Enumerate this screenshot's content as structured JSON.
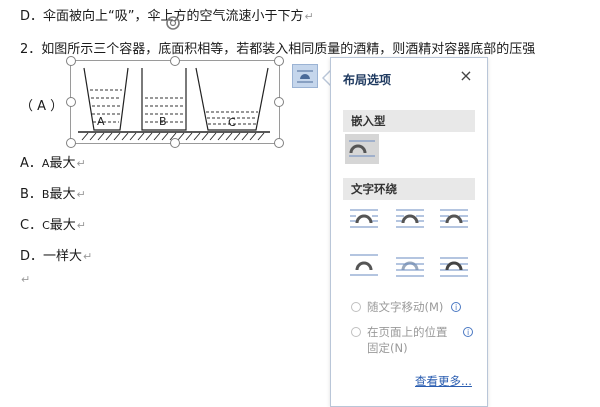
{
  "question": {
    "option_d_prev": "D．伞面被向上“吸”，伞上方的空气流速小于下方",
    "stem": "2．如图所示三个容器，底面积相等，若都装入相同质量的酒精，则酒精对容器底部的压强",
    "answer_open": "（  A  ）",
    "options": [
      {
        "letter_text": "A．",
        "small": "A",
        "text": "最大"
      },
      {
        "letter_text": "B．",
        "small": "B",
        "text": "最大"
      },
      {
        "letter_text": "C．",
        "small": "C",
        "text": "最大"
      },
      {
        "letter_text": "D．",
        "small": "",
        "text": "一样大"
      }
    ],
    "paragraph_mark": "↵",
    "figure_labels": [
      "A",
      "B",
      "C"
    ]
  },
  "layout_panel": {
    "title": "布局选项",
    "close": "×",
    "inline_section": "嵌入型",
    "wrap_section": "文字环绕",
    "move_with_text": "随文字移动(M)",
    "fix_position_line1": "在页面上的位置",
    "fix_position_line2": "固定(N)",
    "info_glyph": "i",
    "see_more": "查看更多..."
  },
  "icons": {
    "layout_button": "layout-options-icon",
    "rotate": "rotate-handle-icon"
  },
  "colors": {
    "panel_title": "#1f3a60",
    "link": "#2a5db0",
    "selected_bg": "#d6d6d6"
  }
}
